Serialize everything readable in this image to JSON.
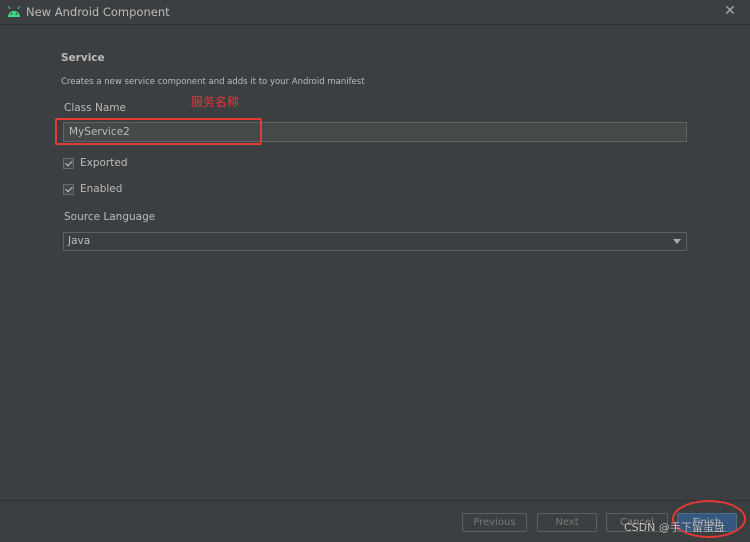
{
  "window": {
    "title": "New Android Component",
    "close_icon": "close-icon",
    "app_icon": "android-icon"
  },
  "form": {
    "heading": "Service",
    "description": "Creates a new service component and adds it to your Android manifest",
    "class_name_label": "Class Name",
    "class_name_value": "MyService2",
    "annotation": "服务名称",
    "exported_label": "Exported",
    "exported_checked": true,
    "enabled_label": "Enabled",
    "enabled_checked": true,
    "source_language_label": "Source Language",
    "source_language_value": "Java"
  },
  "footer": {
    "previous_label": "Previous",
    "next_label": "Next",
    "cancel_label": "Cancel",
    "finish_label": "Finish"
  },
  "watermark": "CSDN @手下留蛋盘",
  "colors": {
    "background": "#3c3f41",
    "annotation_red": "#e53935",
    "primary_button": "#365880",
    "android_green": "#3ddc84"
  }
}
